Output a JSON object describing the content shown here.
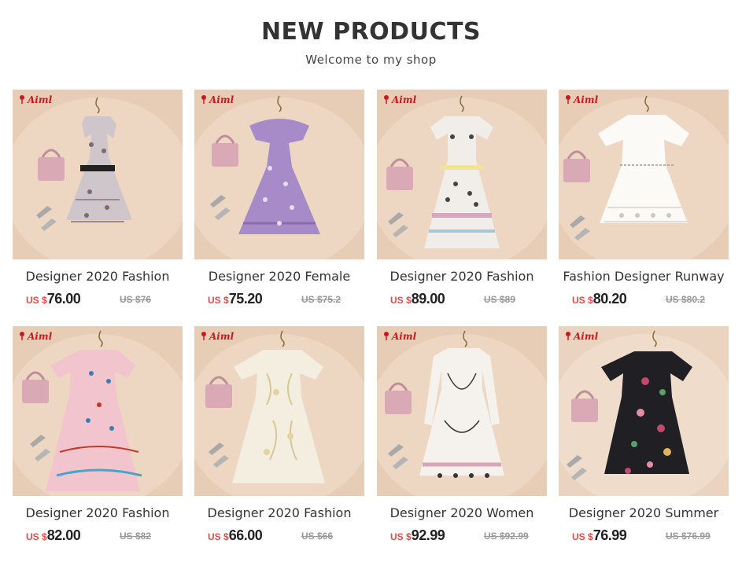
{
  "header": {
    "title": "NEW PRODUCTS",
    "subtitle": "Welcome to my shop"
  },
  "brand_logo_text": "Aiml",
  "colors": {
    "price_currency": "#e34b4b",
    "price_amount": "#222222",
    "old_price": "#999999",
    "logo": "#c8191e",
    "photo_background": "#e6ccb3"
  },
  "products": [
    {
      "name": "Designer 2020 Fashion",
      "currency": "US $",
      "price": "76.00",
      "old_price": "US $76",
      "dress": "floral-print-tiered"
    },
    {
      "name": "Designer 2020 Female",
      "currency": "US $",
      "price": "75.20",
      "old_price": "US $75.2",
      "dress": "lavender-ruffle"
    },
    {
      "name": "Designer 2020 Fashion",
      "currency": "US $",
      "price": "89.00",
      "old_price": "US $89",
      "dress": "white-geometric-print"
    },
    {
      "name": "Fashion Designer Runway",
      "currency": "US $",
      "price": "80.20",
      "old_price": "US $80.2",
      "dress": "white-eyelet-tiered"
    },
    {
      "name": "Designer 2020 Fashion",
      "currency": "US $",
      "price": "82.00",
      "old_price": "US $82",
      "dress": "pink-embroidered-maxi"
    },
    {
      "name": "Designer 2020 Fashion",
      "currency": "US $",
      "price": "66.00",
      "old_price": "US $66",
      "dress": "cream-lace-midi"
    },
    {
      "name": "Designer 2020 Women",
      "currency": "US $",
      "price": "92.99",
      "old_price": "US $92.99",
      "dress": "white-long-sleeve-print"
    },
    {
      "name": "Designer 2020 Summer",
      "currency": "US $",
      "price": "76.99",
      "old_price": "US $76.99",
      "dress": "black-floral-embroidered"
    }
  ]
}
